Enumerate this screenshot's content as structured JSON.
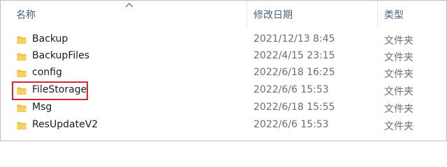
{
  "columns": {
    "name": "名称",
    "modified": "修改日期",
    "type": "类型"
  },
  "sort_icon": "chevron-up-icon",
  "folder_icon": "folder-icon",
  "folder_color": "#f5c542",
  "highlight_color": "#d9262c",
  "rows": [
    {
      "name": "Backup",
      "date": "2021/12/13 8:45",
      "type": "文件夹"
    },
    {
      "name": "BackupFiles",
      "date": "2022/4/15 23:15",
      "type": "文件夹"
    },
    {
      "name": "config",
      "date": "2022/6/18 16:25",
      "type": "文件夹"
    },
    {
      "name": "FileStorage",
      "date": "2022/6/6 15:53",
      "type": "文件夹"
    },
    {
      "name": "Msg",
      "date": "2022/6/18 15:55",
      "type": "文件夹"
    },
    {
      "name": "ResUpdateV2",
      "date": "2022/6/6 15:53",
      "type": "文件夹"
    }
  ]
}
